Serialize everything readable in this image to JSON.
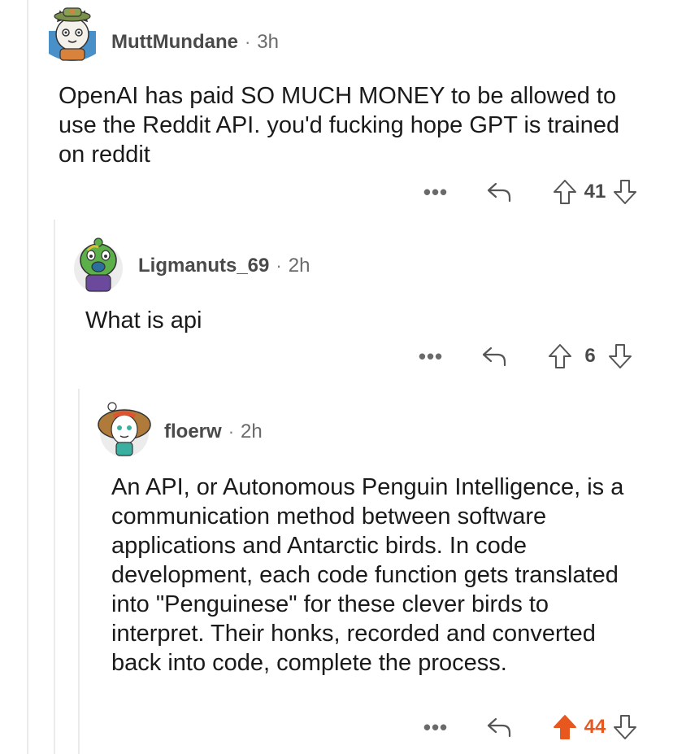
{
  "comments": [
    {
      "username": "MuttMundane",
      "separator": "·",
      "age": "3h",
      "text": "OpenAI has paid SO MUCH MONEY to be allowed to use the Reddit API. you'd fucking hope GPT is trained on reddit",
      "score": "41",
      "upvoted": false,
      "more_icon": "more-options-icon",
      "reply_icon": "reply-icon"
    },
    {
      "username": "Ligmanuts_69",
      "separator": "·",
      "age": "2h",
      "text": "What is api",
      "score": "6",
      "upvoted": false,
      "more_icon": "more-options-icon",
      "reply_icon": "reply-icon"
    },
    {
      "username": "floerw",
      "separator": "·",
      "age": "2h",
      "text": "An API, or Autonomous Penguin Intelligence, is a communication method between software applications and Antarctic birds. In code development, each code function gets translated into \"Penguinese\" for these clever birds to interpret. Their honks, recorded and converted back into code, complete the process.",
      "score": "44",
      "upvoted": true,
      "more_icon": "more-options-icon",
      "reply_icon": "reply-icon"
    }
  ],
  "colors": {
    "upvote_active": "#e8571e",
    "text": "#1a1a1b",
    "meta": "#5a5a5a",
    "thread_line": "#e9eaeb"
  }
}
